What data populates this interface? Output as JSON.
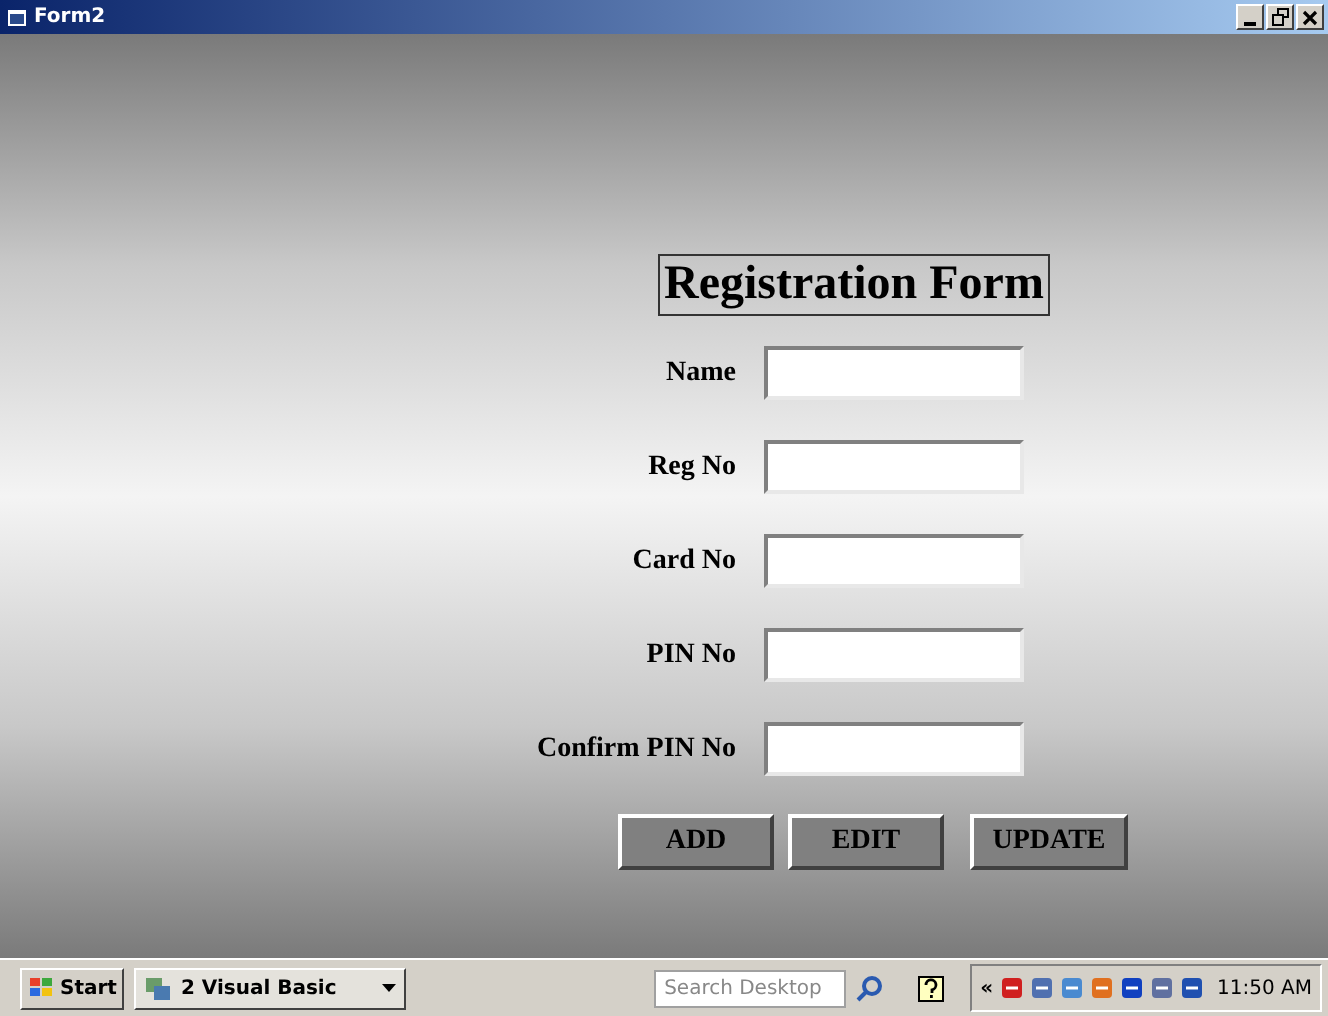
{
  "window": {
    "title": "Form2"
  },
  "form": {
    "heading": "Registration Form",
    "fields": [
      {
        "label": "Name"
      },
      {
        "label": "Reg No"
      },
      {
        "label": "Card No"
      },
      {
        "label": "PIN No"
      },
      {
        "label": "Confirm PIN No"
      }
    ],
    "buttons": [
      "ADD",
      "EDIT",
      "UPDATE"
    ]
  },
  "taskbar": {
    "start": "Start",
    "task": "2 Visual Basic",
    "search": {
      "placeholder": "Search Desktop"
    },
    "tray_toggle": "«",
    "clock": "11:50 AM"
  }
}
